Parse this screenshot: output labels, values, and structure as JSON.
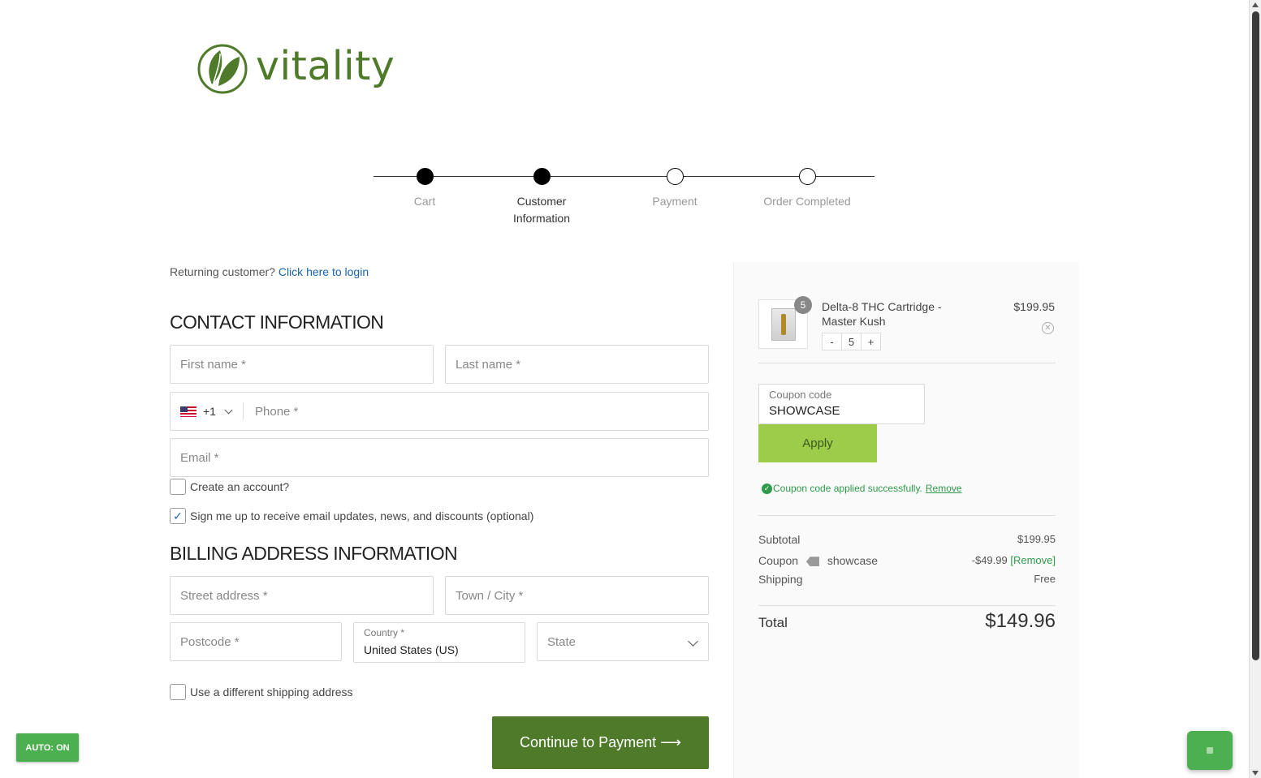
{
  "brand": {
    "name": "vitality",
    "color": "#4e7a2a"
  },
  "steps": [
    {
      "label": "Cart",
      "state": "done"
    },
    {
      "label": "Customer\nInformation",
      "state": "active"
    },
    {
      "label": "Payment",
      "state": "todo"
    },
    {
      "label": "Order Completed",
      "state": "todo"
    }
  ],
  "returning": {
    "text": "Returning customer?",
    "link": "Click here to login"
  },
  "contact": {
    "title": "CONTACT INFORMATION",
    "first_name": "First name *",
    "last_name": "Last name *",
    "phone_code": "+1",
    "phone": "Phone *",
    "email": "Email *",
    "create_account": "Create an account?",
    "newsletter": "Sign me up to receive email updates, news, and discounts (optional)",
    "newsletter_checked": true
  },
  "billing": {
    "title": "BILLING ADDRESS INFORMATION",
    "street": "Street address *",
    "city": "Town / City *",
    "postcode": "Postcode *",
    "country_label": "Country *",
    "country_value": "United States (US)",
    "state": "State",
    "different_shipping": "Use a different shipping address"
  },
  "cta": {
    "label": "Continue to Payment ⟶"
  },
  "cart_item": {
    "name": "Delta-8 THC Cartridge - Master Kush",
    "price": "$199.95",
    "qty": "5",
    "minus": "-",
    "plus": "+"
  },
  "coupon": {
    "label": "Coupon code",
    "value": "SHOWCASE",
    "apply": "Apply",
    "message": "Coupon code applied successfully.",
    "remove": "Remove"
  },
  "totals": {
    "subtotal_label": "Subtotal",
    "subtotal_value": "$199.95",
    "coupon_label": "Coupon",
    "coupon_code": "showcase",
    "coupon_value": "-$49.99",
    "coupon_remove": "[Remove]",
    "shipping_label": "Shipping",
    "shipping_value": "Free",
    "total_label": "Total",
    "total_value": "$149.96"
  },
  "auto_toggle": "AUTO: ON"
}
